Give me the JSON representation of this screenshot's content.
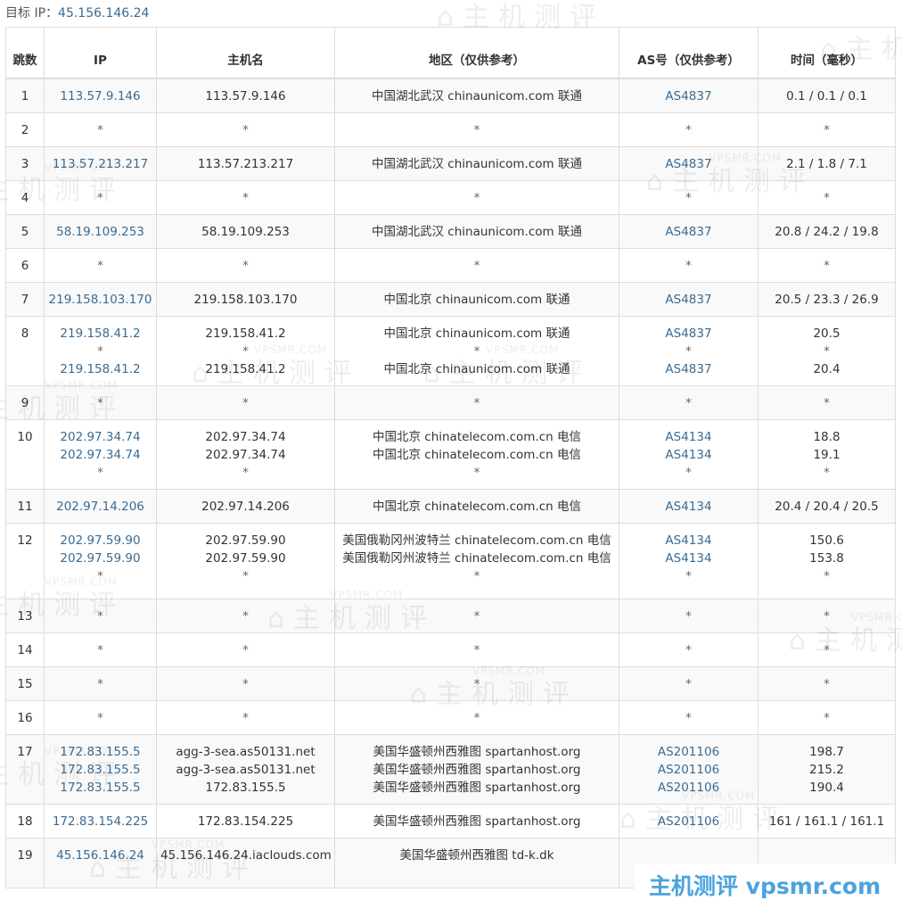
{
  "target": {
    "label": "目标 IP：",
    "ip": "45.156.146.24"
  },
  "columns": [
    "跳数",
    "IP",
    "主机名",
    "地区（仅供参考）",
    "AS号（仅供参考）",
    "时间（毫秒）"
  ],
  "rows": [
    {
      "hop": "1",
      "ip": [
        "113.57.9.146"
      ],
      "host": [
        "113.57.9.146"
      ],
      "region": [
        "中国湖北武汉 chinaunicom.com 联通"
      ],
      "as": [
        "AS4837"
      ],
      "time": [
        "0.1 / 0.1 / 0.1"
      ]
    },
    {
      "hop": "2",
      "ip": [
        "*"
      ],
      "host": [
        "*"
      ],
      "region": [
        "*"
      ],
      "as": [
        "*"
      ],
      "time": [
        "*"
      ]
    },
    {
      "hop": "3",
      "ip": [
        "113.57.213.217"
      ],
      "host": [
        "113.57.213.217"
      ],
      "region": [
        "中国湖北武汉 chinaunicom.com 联通"
      ],
      "as": [
        "AS4837"
      ],
      "time": [
        "2.1 / 1.8 / 7.1"
      ]
    },
    {
      "hop": "4",
      "ip": [
        "*"
      ],
      "host": [
        "*"
      ],
      "region": [
        "*"
      ],
      "as": [
        "*"
      ],
      "time": [
        "*"
      ]
    },
    {
      "hop": "5",
      "ip": [
        "58.19.109.253"
      ],
      "host": [
        "58.19.109.253"
      ],
      "region": [
        "中国湖北武汉 chinaunicom.com 联通"
      ],
      "as": [
        "AS4837"
      ],
      "time": [
        "20.8 / 24.2 / 19.8"
      ]
    },
    {
      "hop": "6",
      "ip": [
        "*"
      ],
      "host": [
        "*"
      ],
      "region": [
        "*"
      ],
      "as": [
        "*"
      ],
      "time": [
        "*"
      ]
    },
    {
      "hop": "7",
      "ip": [
        "219.158.103.170"
      ],
      "host": [
        "219.158.103.170"
      ],
      "region": [
        "中国北京 chinaunicom.com 联通"
      ],
      "as": [
        "AS4837"
      ],
      "time": [
        "20.5 / 23.3 / 26.9"
      ]
    },
    {
      "hop": "8",
      "ip": [
        "219.158.41.2",
        "*",
        "219.158.41.2"
      ],
      "host": [
        "219.158.41.2",
        "*",
        "219.158.41.2"
      ],
      "region": [
        "中国北京 chinaunicom.com 联通",
        "*",
        "中国北京 chinaunicom.com 联通"
      ],
      "as": [
        "AS4837",
        "*",
        "AS4837"
      ],
      "time": [
        "20.5",
        "*",
        "20.4"
      ]
    },
    {
      "hop": "9",
      "ip": [
        "*"
      ],
      "host": [
        "*"
      ],
      "region": [
        "*"
      ],
      "as": [
        "*"
      ],
      "time": [
        "*"
      ]
    },
    {
      "hop": "10",
      "ip": [
        "202.97.34.74",
        "202.97.34.74",
        "*"
      ],
      "host": [
        "202.97.34.74",
        "202.97.34.74",
        "*"
      ],
      "region": [
        "中国北京 chinatelecom.com.cn 电信",
        "中国北京 chinatelecom.com.cn 电信",
        "*"
      ],
      "as": [
        "AS4134",
        "AS4134",
        "*"
      ],
      "time": [
        "18.8",
        "19.1",
        "*"
      ]
    },
    {
      "hop": "11",
      "ip": [
        "202.97.14.206"
      ],
      "host": [
        "202.97.14.206"
      ],
      "region": [
        "中国北京 chinatelecom.com.cn 电信"
      ],
      "as": [
        "AS4134"
      ],
      "time": [
        "20.4 / 20.4 / 20.5"
      ]
    },
    {
      "hop": "12",
      "ip": [
        "202.97.59.90",
        "202.97.59.90",
        "*"
      ],
      "host": [
        "202.97.59.90",
        "202.97.59.90",
        "*"
      ],
      "region": [
        "美国俄勒冈州波特兰 chinatelecom.com.cn 电信",
        "美国俄勒冈州波特兰 chinatelecom.com.cn 电信",
        "*"
      ],
      "as": [
        "AS4134",
        "AS4134",
        "*"
      ],
      "time": [
        "150.6",
        "153.8",
        "*"
      ]
    },
    {
      "hop": "13",
      "ip": [
        "*"
      ],
      "host": [
        "*"
      ],
      "region": [
        "*"
      ],
      "as": [
        "*"
      ],
      "time": [
        "*"
      ]
    },
    {
      "hop": "14",
      "ip": [
        "*"
      ],
      "host": [
        "*"
      ],
      "region": [
        "*"
      ],
      "as": [
        "*"
      ],
      "time": [
        "*"
      ]
    },
    {
      "hop": "15",
      "ip": [
        "*"
      ],
      "host": [
        "*"
      ],
      "region": [
        "*"
      ],
      "as": [
        "*"
      ],
      "time": [
        "*"
      ]
    },
    {
      "hop": "16",
      "ip": [
        "*"
      ],
      "host": [
        "*"
      ],
      "region": [
        "*"
      ],
      "as": [
        "*"
      ],
      "time": [
        "*"
      ]
    },
    {
      "hop": "17",
      "ip": [
        "172.83.155.5",
        "172.83.155.5",
        "172.83.155.5"
      ],
      "host": [
        "agg-3-sea.as50131.net",
        "agg-3-sea.as50131.net",
        "172.83.155.5"
      ],
      "region": [
        "美国华盛顿州西雅图 spartanhost.org",
        "美国华盛顿州西雅图 spartanhost.org",
        "美国华盛顿州西雅图 spartanhost.org"
      ],
      "as": [
        "AS201106",
        "AS201106",
        "AS201106"
      ],
      "time": [
        "198.7",
        "215.2",
        "190.4"
      ]
    },
    {
      "hop": "18",
      "ip": [
        "172.83.154.225"
      ],
      "host": [
        "172.83.154.225"
      ],
      "region": [
        "美国华盛顿州西雅图 spartanhost.org"
      ],
      "as": [
        "AS201106"
      ],
      "time": [
        "161 / 161.1 / 161.1"
      ]
    },
    {
      "hop": "19",
      "ip": [
        "45.156.146.24"
      ],
      "host": [
        "45.156.146.24.iaclouds.com"
      ],
      "region": [
        "美国华盛顿州西雅图 td-k.dk"
      ],
      "as": [
        ""
      ],
      "time": [
        ""
      ]
    }
  ],
  "watermark": {
    "brand": "主机测评",
    "site": "VPSMR.COM"
  },
  "overlay_banner": "主机测评  vpsmr.com"
}
